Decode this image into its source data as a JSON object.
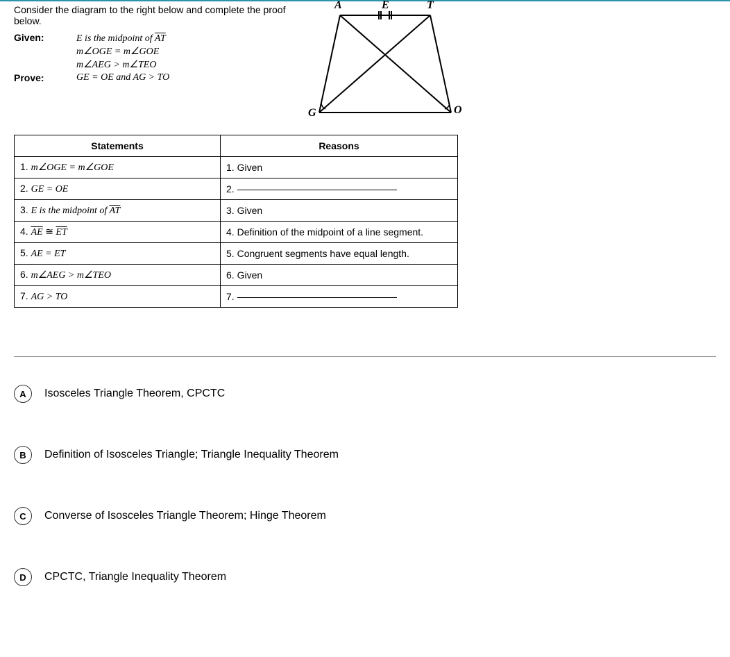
{
  "instruction": "Consider the diagram to the right below and complete the proof below.",
  "given_label": "Given:",
  "prove_label": "Prove:",
  "given_lines": [
    "E is the midpoint of ",
    "m∠OGE = m∠GOE",
    "m∠AEG > m∠TEO"
  ],
  "given_at_seg": "AT",
  "prove_text": "GE = OE and AG > TO",
  "diagram": {
    "A": "A",
    "E": "E",
    "T": "T",
    "G": "G",
    "O": "O"
  },
  "table": {
    "head_statements": "Statements",
    "head_reasons": "Reasons",
    "rows": [
      {
        "num": "1.",
        "s": "m∠OGE = m∠GOE",
        "r": "Given",
        "blank": false
      },
      {
        "num": "2.",
        "s": "GE = OE",
        "r": "",
        "blank": true
      },
      {
        "num": "3.",
        "s": "E is the midpoint of ",
        "seg": "AT",
        "r": "Given",
        "blank": false
      },
      {
        "num": "4.",
        "s": "",
        "seg1": "AE",
        "cong": " ≅ ",
        "seg2": "ET",
        "r": "Definition of the midpoint of a line segment.",
        "blank": false
      },
      {
        "num": "5.",
        "s": "AE = ET",
        "r": "Congruent segments have equal length.",
        "blank": false
      },
      {
        "num": "6.",
        "s": "m∠AEG > m∠TEO",
        "r": "Given",
        "blank": false
      },
      {
        "num": "7.",
        "s": "AG > TO",
        "r": "",
        "blank": true
      }
    ]
  },
  "options": [
    {
      "letter": "A",
      "text": "Isosceles Triangle Theorem, CPCTC"
    },
    {
      "letter": "B",
      "text": "Definition of Isosceles Triangle; Triangle Inequality Theorem"
    },
    {
      "letter": "C",
      "text": "Converse of Isosceles Triangle Theorem; Hinge Theorem"
    },
    {
      "letter": "D",
      "text": "CPCTC, Triangle Inequality Theorem"
    }
  ]
}
